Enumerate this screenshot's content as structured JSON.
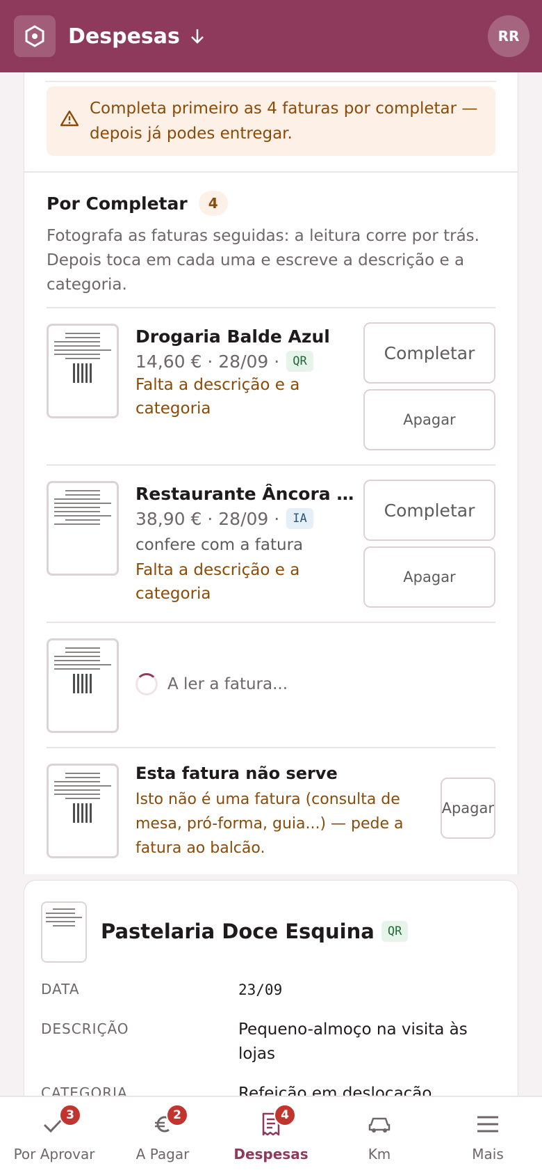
{
  "header": {
    "title": "Despesas",
    "avatar_initials": "RR"
  },
  "warning": {
    "text": "Completa primeiro as 4 faturas por completar — depois já podes entregar."
  },
  "pending": {
    "title": "Por Completar",
    "count": "4",
    "description": "Fotografa as faturas seguidas: a leitura corre por trás. Depois toca em cada uma e escreve a descrição e a categoria."
  },
  "items": [
    {
      "name": "Drogaria Balde Azul",
      "meta": "14,60 € · 28/09 ·",
      "tag": "QR",
      "missing": "Falta a descrição e a categoria",
      "complete_label": "Completar",
      "delete_label": "Apagar"
    },
    {
      "name": "Restaurante Âncora de…",
      "meta": "38,90 € · 28/09 ·",
      "tag": "IA",
      "hint": "confere com a fatura",
      "missing": "Falta a descrição e a categoria",
      "complete_label": "Completar",
      "delete_label": "Apagar"
    }
  ],
  "loading_item": {
    "text": "A ler a fatura..."
  },
  "invalid_item": {
    "title": "Esta fatura não serve",
    "text": "Isto não é uma fatura (consulta de mesa, pró-forma, guia...) — pede a fatura ao balcão.",
    "delete_label": "Apagar"
  },
  "detail": {
    "title": "Pastelaria Doce Esquina",
    "tag": "QR",
    "rows": [
      {
        "label": "DATA",
        "value": "23/09"
      },
      {
        "label": "DESCRIÇÃO",
        "value": "Pequeno-almoço na visita às lojas"
      },
      {
        "label": "CATEGORIA",
        "value": "Refeição em deslocação"
      }
    ]
  },
  "nav": [
    {
      "label": "Por Aprovar",
      "badge": "3",
      "icon": "check-icon"
    },
    {
      "label": "A Pagar",
      "badge": "2",
      "icon": "euro-icon"
    },
    {
      "label": "Despesas",
      "badge": "4",
      "icon": "receipt-icon"
    },
    {
      "label": "Km",
      "icon": "car-icon"
    },
    {
      "label": "Mais",
      "icon": "menu-icon"
    }
  ],
  "colors": {
    "brand": "#8e3a5c",
    "warning_bg": "#fdf0e6",
    "warning_text": "#8a4b08",
    "badge": "#c1352e"
  }
}
